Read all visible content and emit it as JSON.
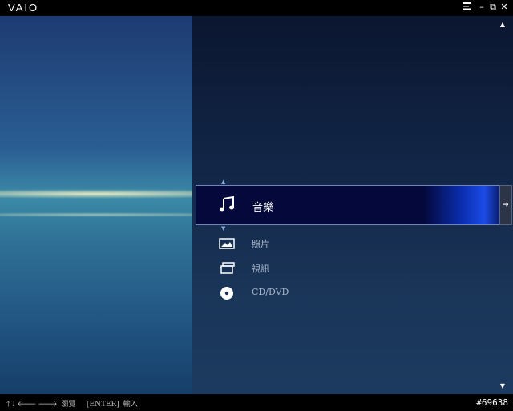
{
  "app": {
    "logo": "VAIO"
  },
  "window_controls": {
    "menu_icon": "menu-icon",
    "minimize": "–",
    "restore": "⧉",
    "close": "✕"
  },
  "menu": {
    "items": [
      {
        "label": "音樂",
        "icon": "music-note-icon",
        "selected": true
      },
      {
        "label": "照片",
        "icon": "photo-icon",
        "selected": false
      },
      {
        "label": "視訊",
        "icon": "video-icon",
        "selected": false
      },
      {
        "label": "CD/DVD",
        "icon": "disc-icon",
        "selected": false
      }
    ]
  },
  "footer": {
    "nav_hint": "瀏覽",
    "enter_key": "[ENTER]",
    "enter_hint": "輸入",
    "code": "#69638"
  },
  "colors": {
    "selection_bg": "#04083a",
    "selection_glow": "#1b4ce6",
    "panel_bg": "#13284a"
  }
}
